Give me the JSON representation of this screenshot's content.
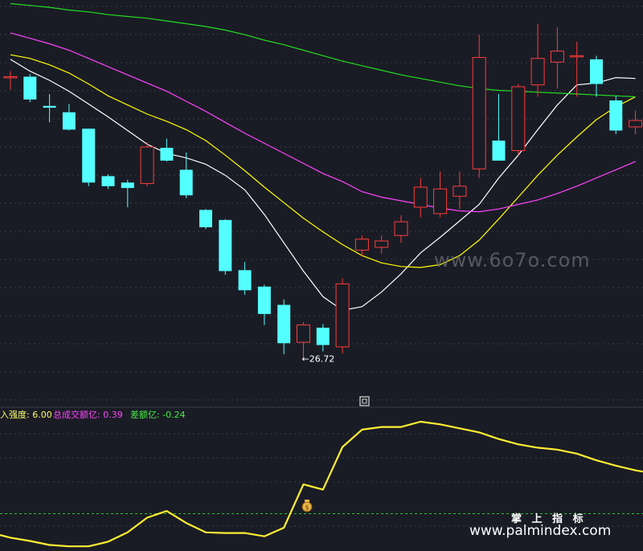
{
  "chart_data": [
    {
      "type": "candlestick",
      "panel": "main",
      "y_range": [
        22.0,
        66.0
      ],
      "low_marker": {
        "text": "←26.72",
        "value": 26.72,
        "candle_index": 15
      },
      "colors": {
        "up": "#ff3b3b",
        "down": "#54ffff",
        "background": "#1a1c25",
        "grid": "#3a3c46"
      },
      "candles": [
        {
          "o": 57.6,
          "h": 58.2,
          "l": 56.2,
          "c": 57.6
        },
        {
          "o": 57.6,
          "h": 57.9,
          "l": 54.8,
          "c": 55.1
        },
        {
          "o": 54.4,
          "h": 55.7,
          "l": 52.6,
          "c": 54.2
        },
        {
          "o": 53.7,
          "h": 54.6,
          "l": 51.7,
          "c": 51.8
        },
        {
          "o": 51.9,
          "h": 51.9,
          "l": 45.6,
          "c": 46.0
        },
        {
          "o": 46.7,
          "h": 46.9,
          "l": 45.3,
          "c": 45.6
        },
        {
          "o": 46.0,
          "h": 46.3,
          "l": 43.3,
          "c": 45.4
        },
        {
          "o": 45.9,
          "h": 50.4,
          "l": 45.6,
          "c": 49.9
        },
        {
          "o": 49.8,
          "h": 50.8,
          "l": 48.3,
          "c": 48.4
        },
        {
          "o": 47.4,
          "h": 49.3,
          "l": 44.3,
          "c": 44.6
        },
        {
          "o": 43.0,
          "h": 43.1,
          "l": 40.9,
          "c": 41.1
        },
        {
          "o": 41.9,
          "h": 42.0,
          "l": 35.9,
          "c": 36.3
        },
        {
          "o": 36.4,
          "h": 37.3,
          "l": 33.7,
          "c": 34.2
        },
        {
          "o": 34.6,
          "h": 34.8,
          "l": 30.4,
          "c": 31.6
        },
        {
          "o": 32.6,
          "h": 33.2,
          "l": 27.2,
          "c": 28.4
        },
        {
          "o": 28.5,
          "h": 30.7,
          "l": 26.72,
          "c": 30.4
        },
        {
          "o": 30.1,
          "h": 30.5,
          "l": 27.5,
          "c": 28.2
        },
        {
          "o": 28.0,
          "h": 35.5,
          "l": 27.3,
          "c": 34.9
        },
        {
          "o": 38.6,
          "h": 40.2,
          "l": 37.9,
          "c": 39.8
        },
        {
          "o": 38.9,
          "h": 40.2,
          "l": 38.2,
          "c": 39.6
        },
        {
          "o": 40.2,
          "h": 42.4,
          "l": 39.4,
          "c": 41.7
        },
        {
          "o": 43.3,
          "h": 46.5,
          "l": 42.2,
          "c": 45.5
        },
        {
          "o": 42.6,
          "h": 47.2,
          "l": 42.2,
          "c": 45.3
        },
        {
          "o": 44.5,
          "h": 47.2,
          "l": 43.1,
          "c": 45.6
        },
        {
          "o": 47.5,
          "h": 62.2,
          "l": 46.5,
          "c": 59.7
        },
        {
          "o": 50.6,
          "h": 55.7,
          "l": 49.2,
          "c": 48.4
        },
        {
          "o": 49.5,
          "h": 56.8,
          "l": 49.0,
          "c": 56.5
        },
        {
          "o": 56.7,
          "h": 63.4,
          "l": 55.4,
          "c": 59.6
        },
        {
          "o": 59.2,
          "h": 63.0,
          "l": 56.3,
          "c": 60.4
        },
        {
          "o": 59.9,
          "h": 61.4,
          "l": 55.4,
          "c": 59.9
        },
        {
          "o": 59.5,
          "h": 59.9,
          "l": 55.4,
          "c": 56.8
        },
        {
          "o": 55.0,
          "h": 55.5,
          "l": 51.3,
          "c": 51.7
        },
        {
          "o": 52.1,
          "h": 53.9,
          "l": 51.3,
          "c": 52.8
        }
      ],
      "moving_averages": [
        {
          "name": "",
          "color": "#ffffff",
          "values": [
            59.5,
            58.2,
            57.2,
            56.0,
            54.6,
            53.2,
            51.7,
            50.2,
            49.2,
            48.7,
            48.0,
            46.8,
            45.2,
            42.5,
            39.4,
            36.3,
            33.5,
            32.0,
            32.4,
            34.0,
            36.0,
            38.3,
            40.0,
            41.8,
            43.6,
            46.5,
            49.0,
            51.8,
            54.5,
            56.7,
            56.9,
            57.5,
            57.4
          ]
        },
        {
          "name": "",
          "color": "#ffff00",
          "values": [
            60.0,
            59.6,
            58.9,
            58.0,
            56.8,
            55.5,
            54.5,
            53.5,
            52.7,
            51.8,
            50.6,
            49.0,
            47.3,
            45.5,
            43.8,
            42.1,
            40.6,
            39.2,
            38.0,
            37.2,
            36.8,
            36.7,
            37.0,
            38.0,
            39.7,
            42.0,
            44.4,
            46.8,
            49.0,
            51.0,
            52.9,
            54.3,
            55.4
          ]
        },
        {
          "name": "",
          "color": "#ff44ff",
          "values": [
            62.4,
            61.8,
            61.2,
            60.5,
            59.6,
            58.7,
            57.8,
            56.9,
            56.0,
            54.9,
            53.8,
            52.6,
            51.4,
            50.3,
            49.2,
            48.1,
            47.0,
            46.1,
            45.0,
            44.4,
            44.0,
            43.6,
            43.2,
            42.9,
            42.8,
            43.1,
            43.6,
            44.1,
            44.8,
            45.6,
            46.5,
            47.4,
            48.3
          ]
        },
        {
          "name": "",
          "color": "#22dd22",
          "values": [
            65.6,
            65.4,
            65.2,
            64.9,
            64.7,
            64.4,
            64.2,
            64.0,
            63.7,
            63.4,
            63.1,
            62.7,
            62.2,
            61.6,
            61.1,
            60.5,
            59.9,
            59.3,
            58.8,
            58.3,
            57.8,
            57.4,
            57.0,
            56.6,
            56.3,
            56.1,
            56.0,
            55.9,
            55.8,
            55.7,
            55.6,
            55.5,
            55.4
          ]
        }
      ]
    },
    {
      "type": "line",
      "panel": "indicator",
      "y_range": [
        0,
        100
      ],
      "reference_line": {
        "value": 28,
        "color": "#22cc22"
      },
      "labels": [
        {
          "text": "入强度: 6.00",
          "color": "#ffff66"
        },
        {
          "text": "总成交额亿: 0.39",
          "color": "#ff44ff"
        },
        {
          "text": "差额亿: -0.24",
          "color": "#44ee44"
        }
      ],
      "series": [
        {
          "name": "",
          "color": "#ffee33",
          "values": [
            10.0,
            7.5,
            4.5,
            3.5,
            3.5,
            7.0,
            14.0,
            25.0,
            30.0,
            21.0,
            14.0,
            13.5,
            13.5,
            11.0,
            17.5,
            50.0,
            46.0,
            78.0,
            91.0,
            93.0,
            93.0,
            97.0,
            95.0,
            92.0,
            89.0,
            84.0,
            80.0,
            77.5,
            76.0,
            73.0,
            68.0,
            64.0,
            60.5
          ]
        }
      ]
    }
  ],
  "watermark": {
    "site1": "www.6o7o.com",
    "cn": "掌 上 指 标",
    "site2": "www.palmindex.com"
  }
}
